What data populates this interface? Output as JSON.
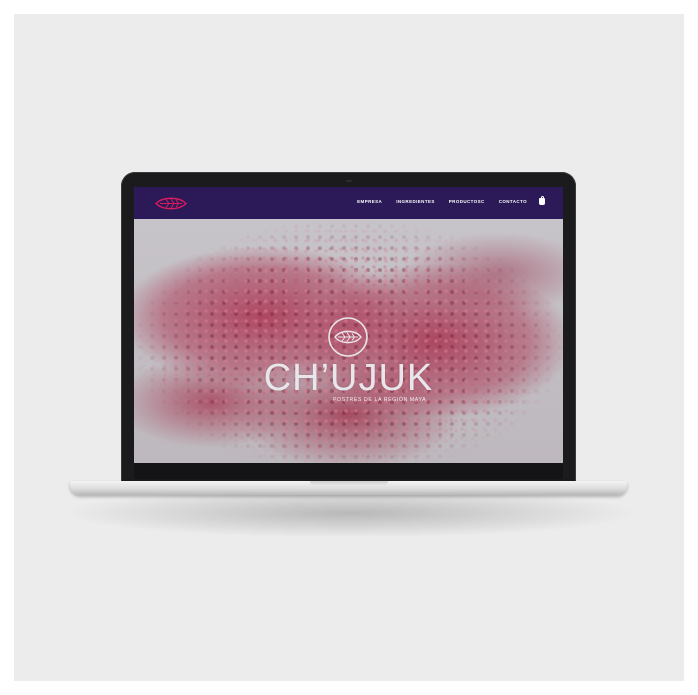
{
  "site": {
    "brand_name": "CH’UJUK",
    "tagline": "POSTRES DE LA REGIÓN MAYA",
    "logo_icon": "leaf-logo-icon",
    "nav": {
      "items": [
        {
          "label": "EMPRESA"
        },
        {
          "label": "INGREDIENTES"
        },
        {
          "label": "PRODUCTOSC"
        },
        {
          "label": "CONTACTO"
        }
      ],
      "cart_icon": "cart-icon"
    },
    "colors": {
      "navbar": "#2b1a57",
      "logo_accent": "#d81a5f",
      "hero_product": "#ad405c",
      "brand_text": "#e8e6ea"
    }
  }
}
